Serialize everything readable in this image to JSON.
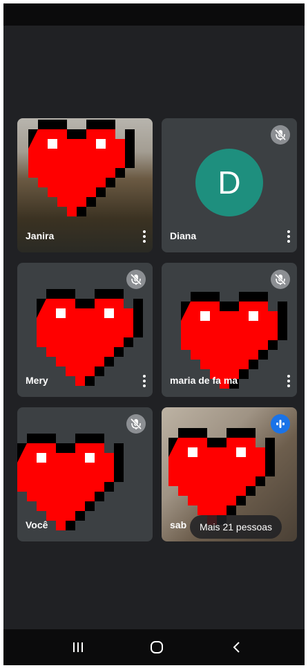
{
  "participants": [
    {
      "name": "Janira",
      "mic": "on",
      "video": true
    },
    {
      "name": "Diana",
      "mic": "muted",
      "video": false,
      "avatar_letter": "D",
      "avatar_color": "#1e8f7e"
    },
    {
      "name": "Mery",
      "mic": "muted",
      "video": true
    },
    {
      "name": "maria de fa  ma",
      "mic": "muted",
      "video": true
    },
    {
      "name": "Você",
      "mic": "muted",
      "video": true
    },
    {
      "name": "sab",
      "mic": "speaking",
      "video": true
    }
  ],
  "more_people_label": "Mais 21 pessoas",
  "colors": {
    "background": "#202124",
    "tile": "#3c4043",
    "speaking_indicator": "#1a73e8",
    "heart_red": "#ff0000"
  },
  "icons": [
    "mic-off-icon",
    "more-options-icon",
    "speaking-indicator-icon",
    "recent-apps-icon",
    "home-icon",
    "back-icon"
  ]
}
